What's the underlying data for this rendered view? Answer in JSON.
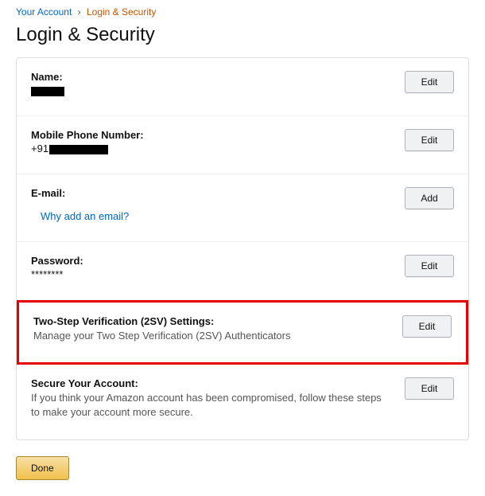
{
  "breadcrumb": {
    "parent": "Your Account",
    "current": "Login & Security"
  },
  "page_title": "Login & Security",
  "rows": {
    "name": {
      "label": "Name:",
      "button": "Edit"
    },
    "phone": {
      "label": "Mobile Phone Number:",
      "prefix": "+91",
      "button": "Edit"
    },
    "email": {
      "label": "E-mail:",
      "link": "Why add an email?",
      "button": "Add"
    },
    "password": {
      "label": "Password:",
      "value": "********",
      "button": "Edit"
    },
    "twosv": {
      "label": "Two-Step Verification (2SV) Settings:",
      "desc": "Manage your Two Step Verification (2SV) Authenticators",
      "button": "Edit"
    },
    "secure": {
      "label": "Secure Your Account:",
      "desc": "If you think your Amazon account has been compromised, follow these steps to make your account more secure.",
      "button": "Edit"
    }
  },
  "done_label": "Done"
}
